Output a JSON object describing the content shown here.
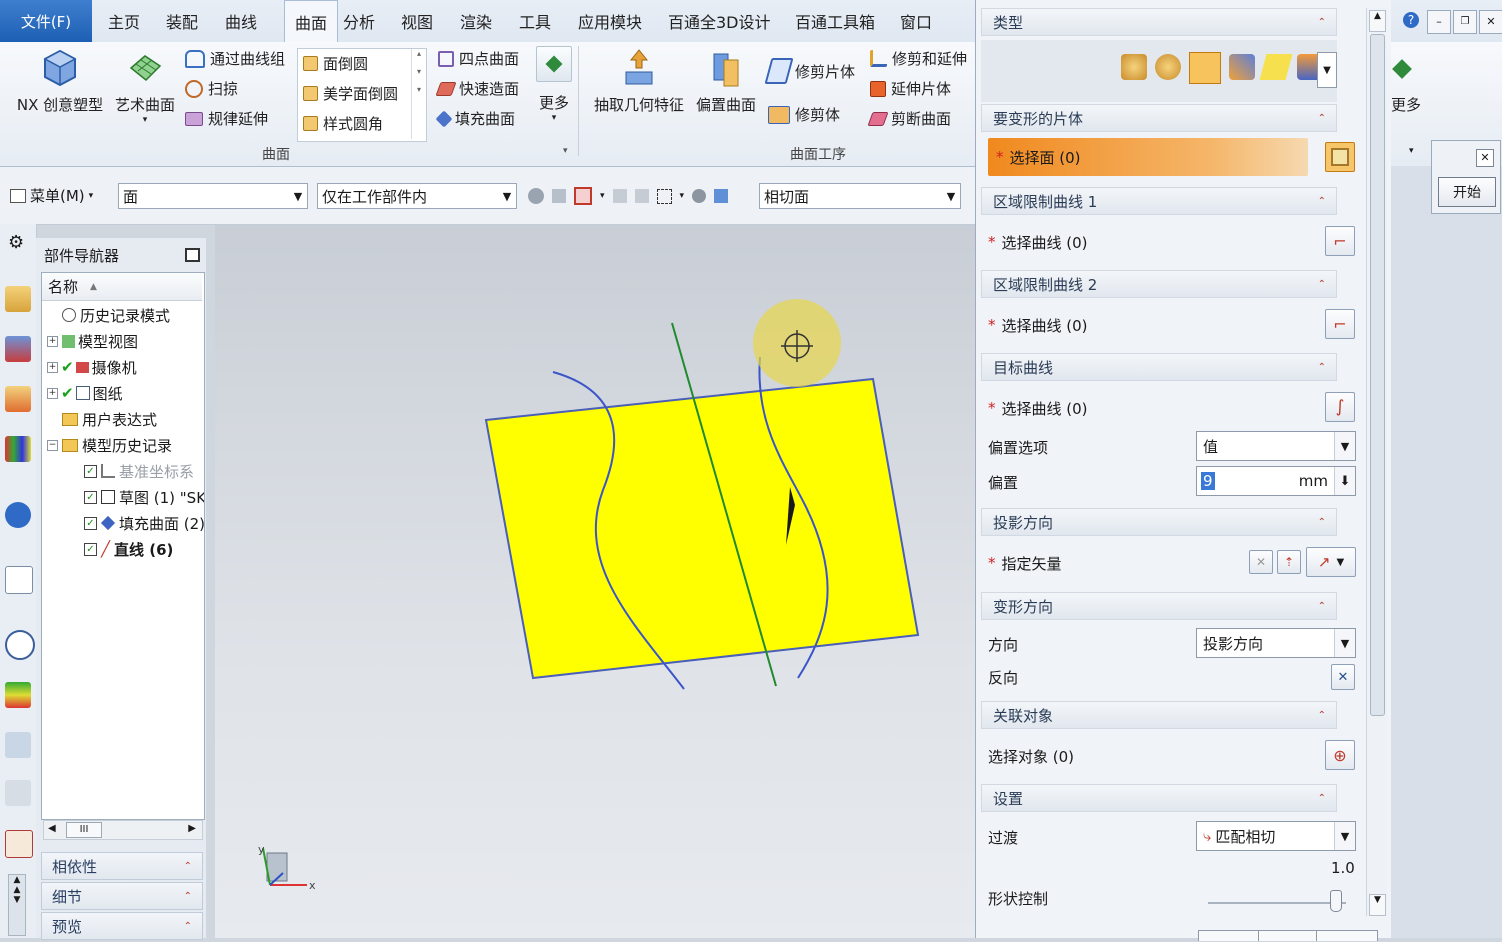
{
  "menubar": {
    "file": "文件(F)",
    "tabs": [
      "主页",
      "装配",
      "曲线",
      "曲面",
      "分析",
      "视图",
      "渲染",
      "工具",
      "应用模块",
      "百通全3D设计",
      "百通工具箱",
      "窗口"
    ],
    "active_tab": "曲面"
  },
  "ribbon": {
    "nx_creative": "NX 创意塑型",
    "art_surface": "艺术曲面",
    "through_curves": "通过曲线组",
    "sweep": "扫掠",
    "law_extension": "规律延伸",
    "face_blend": "面倒圆",
    "aesthetic_blend": "美学面倒圆",
    "style_blend": "样式圆角",
    "four_point": "四点曲面",
    "rapid_surface": "快速造面",
    "fill_surface": "填充曲面",
    "more1": "更多",
    "surface_group": "曲面",
    "extract_geometry": "抽取几何特征",
    "offset_surface": "偏置曲面",
    "trim_sheet": "修剪片体",
    "trim_body": "修剪体",
    "trim_extend": "修剪和延伸",
    "extend_sheet": "延伸片体",
    "divide_face": "剪断曲面",
    "surface_ops_group": "曲面工序"
  },
  "cmdbar": {
    "menu": "菜单(M)",
    "filter": "面",
    "scope": "仅在工作部件内",
    "snap": "相切面"
  },
  "navigator": {
    "title": "部件导航器",
    "col_name": "名称",
    "nodes": [
      {
        "label": "历史记录模式"
      },
      {
        "label": "模型视图"
      },
      {
        "label": "摄像机"
      },
      {
        "label": "图纸"
      },
      {
        "label": "用户表达式"
      },
      {
        "label": "模型历史记录"
      },
      {
        "label": "基准坐标系"
      },
      {
        "label": "草图 (1) \"SK"
      },
      {
        "label": "填充曲面 (2)"
      },
      {
        "label": "直线 (6)"
      }
    ],
    "panes": [
      "相依性",
      "细节",
      "预览"
    ]
  },
  "dialog": {
    "type_header": "类型",
    "sheet_header": "要变形的片体",
    "select_face": "选择面 (0)",
    "region_curve1_header": "区域限制曲线 1",
    "region_curve1_select": "选择曲线 (0)",
    "region_curve2_header": "区域限制曲线 2",
    "region_curve2_select": "选择曲线 (0)",
    "target_header": "目标曲线",
    "target_select": "选择曲线 (0)",
    "offset_option_label": "偏置选项",
    "offset_option_value": "值",
    "offset_label": "偏置",
    "offset_value": "9",
    "offset_unit": "mm",
    "proj_header": "投影方向",
    "specify_vector": "指定矢量",
    "deform_header": "变形方向",
    "direction_label": "方向",
    "direction_value": "投影方向",
    "reverse_label": "反向",
    "assoc_header": "关联对象",
    "select_object": "选择对象 (0)",
    "settings_header": "设置",
    "transition_label": "过渡",
    "transition_value": "匹配相切",
    "shape_value": "1.0",
    "shape_label": "形状控制"
  },
  "right_panel": {
    "start": "开始",
    "more": "更多"
  },
  "colors": {
    "surface": "#ffff00",
    "curve": "#3b55c9",
    "axis_line": "#1f8a2e",
    "highlight": "#f0a02e"
  }
}
